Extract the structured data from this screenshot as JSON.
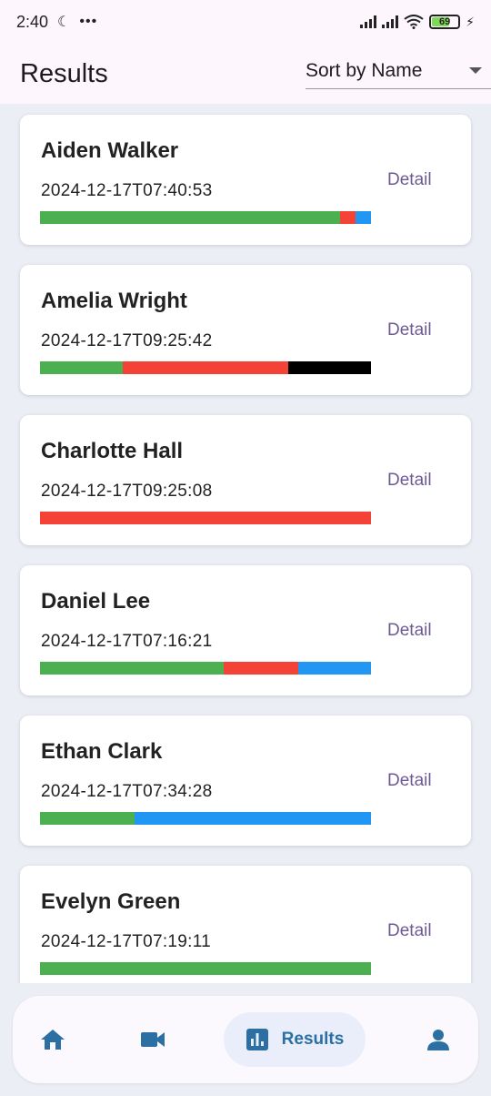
{
  "status_bar": {
    "time": "2:40",
    "battery": "69"
  },
  "header": {
    "title": "Results",
    "sort_label": "Sort by Name"
  },
  "colors": {
    "green": "#4caf50",
    "red": "#f44336",
    "blue": "#2196f3",
    "black": "#000000",
    "accent": "#2c6fa3"
  },
  "results": [
    {
      "name": "Aiden Walker",
      "timestamp": "2024-12-17T07:40:53",
      "detail_label": "Detail",
      "segments": [
        {
          "color": "green",
          "fraction": 0.907
        },
        {
          "color": "red",
          "fraction": 0.047
        },
        {
          "color": "blue",
          "fraction": 0.046
        }
      ]
    },
    {
      "name": "Amelia Wright",
      "timestamp": "2024-12-17T09:25:42",
      "detail_label": "Detail",
      "segments": [
        {
          "color": "green",
          "fraction": 0.25
        },
        {
          "color": "red",
          "fraction": 0.5
        },
        {
          "color": "black",
          "fraction": 0.25
        }
      ]
    },
    {
      "name": "Charlotte Hall",
      "timestamp": "2024-12-17T09:25:08",
      "detail_label": "Detail",
      "segments": [
        {
          "color": "red",
          "fraction": 1.0
        }
      ]
    },
    {
      "name": "Daniel Lee",
      "timestamp": "2024-12-17T07:16:21",
      "detail_label": "Detail",
      "segments": [
        {
          "color": "green",
          "fraction": 0.555
        },
        {
          "color": "red",
          "fraction": 0.225
        },
        {
          "color": "blue",
          "fraction": 0.22
        }
      ]
    },
    {
      "name": "Ethan Clark",
      "timestamp": "2024-12-17T07:34:28",
      "detail_label": "Detail",
      "segments": [
        {
          "color": "green",
          "fraction": 0.286
        },
        {
          "color": "blue",
          "fraction": 0.714
        }
      ]
    },
    {
      "name": "Evelyn Green",
      "timestamp": "2024-12-17T07:19:11",
      "detail_label": "Detail",
      "segments": [
        {
          "color": "green",
          "fraction": 1.0
        }
      ]
    }
  ],
  "nav": {
    "items": [
      {
        "icon": "home-icon"
      },
      {
        "icon": "video-camera-icon"
      },
      {
        "icon": "bar-chart-icon",
        "label": "Results",
        "selected": true
      },
      {
        "icon": "person-icon"
      }
    ]
  }
}
